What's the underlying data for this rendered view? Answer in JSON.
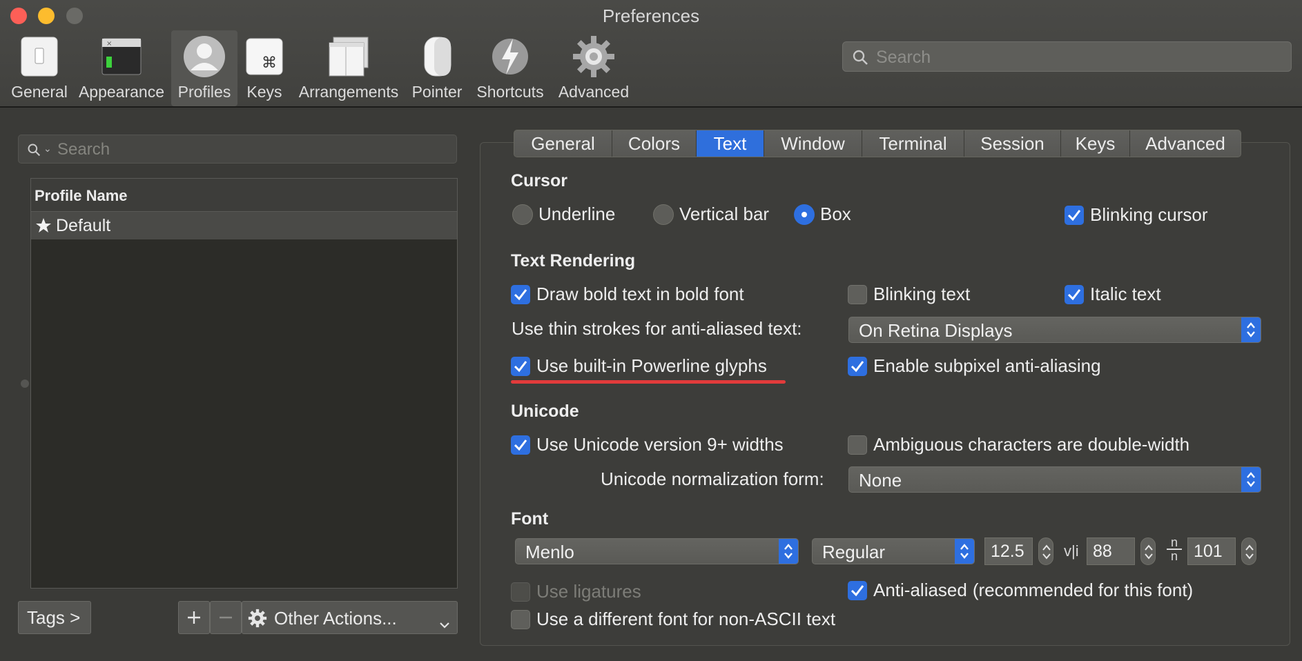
{
  "window": {
    "title": "Preferences"
  },
  "toolbar": {
    "items": [
      {
        "label": "General",
        "icon": "switch-icon"
      },
      {
        "label": "Appearance",
        "icon": "terminal-window-icon"
      },
      {
        "label": "Profiles",
        "icon": "person-icon"
      },
      {
        "label": "Keys",
        "icon": "command-key-icon"
      },
      {
        "label": "Arrangements",
        "icon": "windows-icon"
      },
      {
        "label": "Pointer",
        "icon": "mouse-icon"
      },
      {
        "label": "Shortcuts",
        "icon": "lightning-icon"
      },
      {
        "label": "Advanced",
        "icon": "gear-icon"
      }
    ],
    "active": "Profiles",
    "search_placeholder": "Search"
  },
  "profiles": {
    "search_placeholder": "Search",
    "column_header": "Profile Name",
    "rows": [
      {
        "name": "Default",
        "default": true
      }
    ],
    "tags_label": "Tags >",
    "plus_label": "+",
    "minus_label": "—",
    "other_actions_label": "Other Actions..."
  },
  "tabs": {
    "items": [
      "General",
      "Colors",
      "Text",
      "Window",
      "Terminal",
      "Session",
      "Keys",
      "Advanced"
    ],
    "active": "Text"
  },
  "cursor": {
    "heading": "Cursor",
    "options": [
      {
        "label": "Underline",
        "selected": false
      },
      {
        "label": "Vertical bar",
        "selected": false
      },
      {
        "label": "Box",
        "selected": true
      }
    ],
    "blinking": {
      "label": "Blinking cursor",
      "checked": true
    }
  },
  "text_rendering": {
    "heading": "Text Rendering",
    "bold": {
      "label": "Draw bold text in bold font",
      "checked": true
    },
    "blinking_text": {
      "label": "Blinking text",
      "checked": false
    },
    "italic": {
      "label": "Italic text",
      "checked": true
    },
    "thin_strokes_label": "Use thin strokes for anti-aliased text:",
    "thin_strokes_value": "On Retina Displays",
    "powerline": {
      "label": "Use built-in Powerline glyphs",
      "checked": true
    },
    "subpixel": {
      "label": "Enable subpixel anti-aliasing",
      "checked": true
    }
  },
  "unicode": {
    "heading": "Unicode",
    "v9_widths": {
      "label": "Use Unicode version 9+ widths",
      "checked": true
    },
    "ambiguous": {
      "label": "Ambiguous characters are double-width",
      "checked": false
    },
    "normalization_label": "Unicode normalization form:",
    "normalization_value": "None"
  },
  "font": {
    "heading": "Font",
    "family": "Menlo",
    "weight": "Regular",
    "size": "12.5",
    "vertical_spacing_glyph": "v|i",
    "vertical_spacing": "88",
    "horizontal_spacing_glyph_top": "n",
    "horizontal_spacing_glyph_bottom": "n",
    "horizontal_spacing": "101",
    "ligatures": {
      "label": "Use ligatures",
      "checked": false,
      "disabled": true
    },
    "anti_aliased": {
      "label": "Anti-aliased",
      "checked": true
    },
    "anti_aliased_note": "(recommended for this font)",
    "non_ascii": {
      "label": "Use a different font for non-ASCII text",
      "checked": false
    }
  },
  "colors": {
    "accent": "#2e6fe0",
    "annotation_underline": "#e23b3b"
  }
}
